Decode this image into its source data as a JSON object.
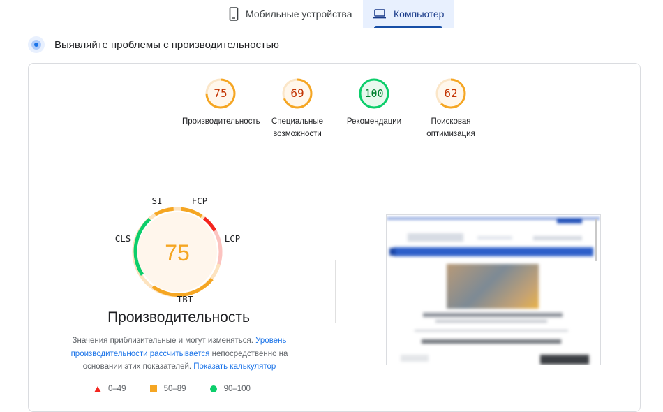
{
  "tabs": [
    {
      "label": "Мобильные устройства",
      "icon": "phone-icon",
      "active": false
    },
    {
      "label": "Компьютер",
      "icon": "laptop-icon",
      "active": true
    }
  ],
  "section": {
    "title": "Выявляйте проблемы с производительностью",
    "icon": "diagnose-pulse-icon"
  },
  "scores": [
    {
      "value": 75,
      "label": "Производительность",
      "color": "#f5a623"
    },
    {
      "value": 69,
      "label": "Специальные\nвозможности",
      "color": "#f5a623"
    },
    {
      "value": 100,
      "label": "Рекомендации",
      "color": "#0cce6b"
    },
    {
      "value": 62,
      "label": "Поисковая\nоптимизация",
      "color": "#f5a623"
    }
  ],
  "performance": {
    "score": 75,
    "title": "Производительность",
    "metrics": [
      "SI",
      "FCP",
      "LCP",
      "TBT",
      "CLS"
    ],
    "metric_colors": {
      "SI": "#f5a623",
      "FCP": "#f5a623",
      "LCP": "#f4251e",
      "TBT": "#f5a623",
      "CLS": "#0cce6b"
    },
    "description_prefix": "Значения приблизительные и могут изменяться. ",
    "description_link1": "Уровень производительности рассчитывается",
    "description_middle": " непосредственно на основании этих показателей. ",
    "description_link2": "Показать калькулятор"
  },
  "legend": [
    {
      "range": "0–49",
      "shape": "triangle",
      "color": "#f4251e"
    },
    {
      "range": "50–89",
      "shape": "square",
      "color": "#f5a623"
    },
    {
      "range": "90–100",
      "shape": "circle",
      "color": "#0cce6b"
    }
  ],
  "colors": {
    "accent": "#1a73e8",
    "average": "#f5a623",
    "fail": "#f4251e",
    "pass": "#0cce6b"
  }
}
